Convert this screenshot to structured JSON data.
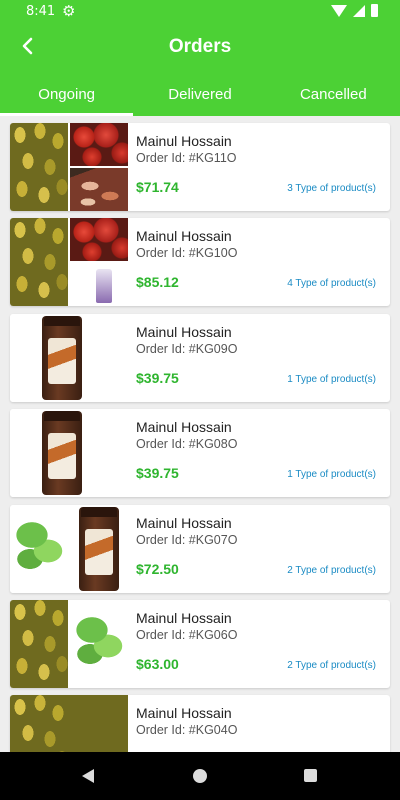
{
  "status_bar": {
    "time": "8:41",
    "gear_icon": "gear-icon",
    "wifi_icon": "wifi-icon",
    "signal_icon": "signal-icon",
    "battery_icon": "battery-icon"
  },
  "header": {
    "title": "Orders",
    "back_icon": "back-arrow-icon",
    "background": "#4cd135"
  },
  "tabs": [
    {
      "label": "Ongoing",
      "active": true
    },
    {
      "label": "Delivered",
      "active": false
    },
    {
      "label": "Cancelled",
      "active": false
    }
  ],
  "orders": [
    {
      "customer": "Mainul Hossain",
      "order_id": "Order Id: #KG11O",
      "price": "$71.74",
      "types": "3 Type of product(s)"
    },
    {
      "customer": "Mainul Hossain",
      "order_id": "Order Id: #KG10O",
      "price": "$85.12",
      "types": "4 Type of product(s)"
    },
    {
      "customer": "Mainul Hossain",
      "order_id": "Order Id: #KG09O",
      "price": "$39.75",
      "types": "1 Type of product(s)"
    },
    {
      "customer": "Mainul Hossain",
      "order_id": "Order Id: #KG08O",
      "price": "$39.75",
      "types": "1 Type of product(s)"
    },
    {
      "customer": "Mainul Hossain",
      "order_id": "Order Id: #KG07O",
      "price": "$72.50",
      "types": "2 Type of product(s)"
    },
    {
      "customer": "Mainul Hossain",
      "order_id": "Order Id: #KG06O",
      "price": "$63.00",
      "types": "2 Type of product(s)"
    },
    {
      "customer": "Mainul Hossain",
      "order_id": "Order Id: #KG04O",
      "price": "",
      "types": ""
    }
  ],
  "nav_bar": {
    "back_icon": "nav-back-icon",
    "home_icon": "nav-home-icon",
    "recents_icon": "nav-recents-icon"
  },
  "colors": {
    "accent": "#4cd135",
    "price": "#2fb52f",
    "link": "#1a8bc4"
  }
}
